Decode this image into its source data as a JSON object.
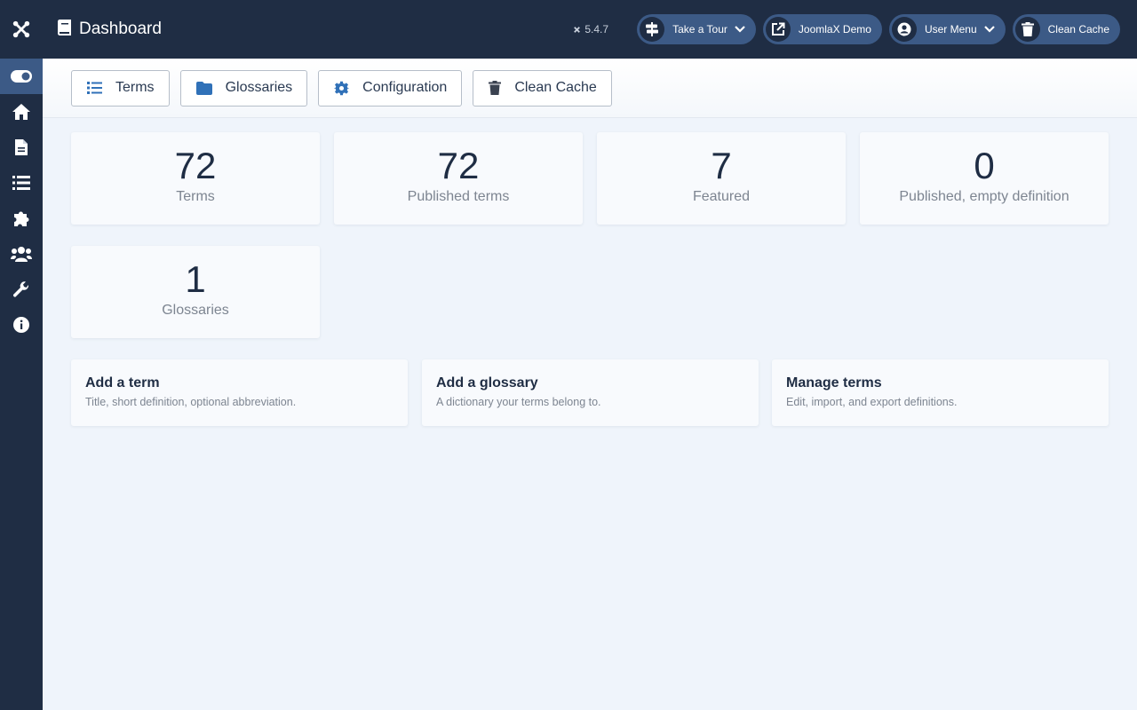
{
  "header": {
    "title": "Dashboard",
    "version": "5.4.7",
    "pills": [
      {
        "label": "Take a Tour"
      },
      {
        "label": "JoomlaX Demo"
      },
      {
        "label": "User Menu"
      },
      {
        "label": "Clean Cache"
      }
    ]
  },
  "sidebar": {
    "items": [
      "toggle-menu-icon",
      "home-icon",
      "document-icon",
      "list-icon",
      "puzzle-icon",
      "users-icon",
      "wrench-icon",
      "info-icon"
    ]
  },
  "toolbar": {
    "terms": "Terms",
    "glossaries": "Glossaries",
    "configuration": "Configuration",
    "clean_cache": "Clean Cache"
  },
  "stats": [
    {
      "value": "72",
      "label": "Terms"
    },
    {
      "value": "72",
      "label": "Published terms"
    },
    {
      "value": "7",
      "label": "Featured"
    },
    {
      "value": "0",
      "label": "Published, empty definition"
    },
    {
      "value": "1",
      "label": "Glossaries"
    }
  ],
  "actions": [
    {
      "title": "Add a term",
      "desc": "Title, short definition, optional abbreviation."
    },
    {
      "title": "Add a glossary",
      "desc": "A dictionary your terms belong to."
    },
    {
      "title": "Manage terms",
      "desc": "Edit, import, and export definitions."
    }
  ],
  "colors": {
    "sidebar": "#1f2d44",
    "accent": "#3c5a86",
    "background": "#eff4fb",
    "icon_blue": "#3071b8"
  }
}
